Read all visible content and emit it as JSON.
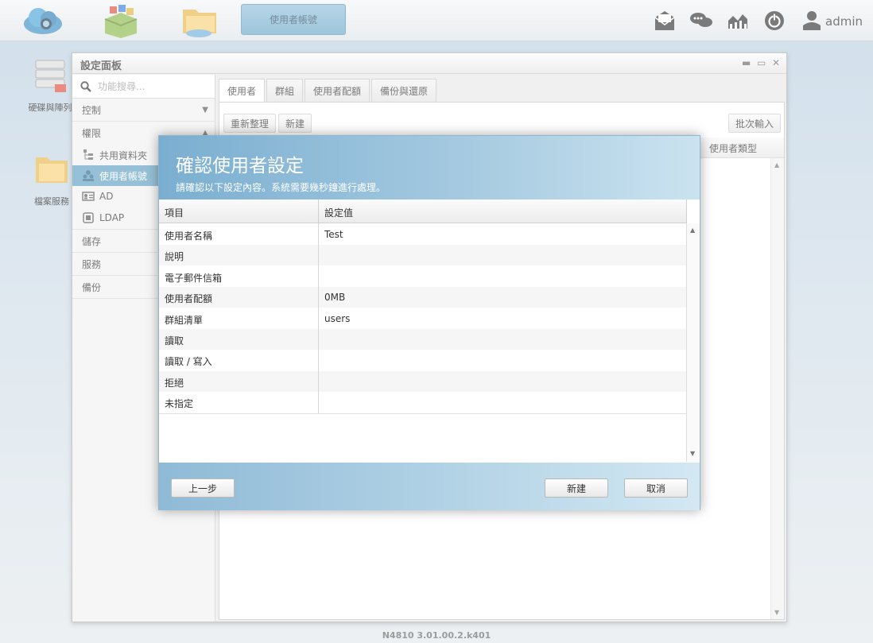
{
  "topbar": {
    "active_app": "使用者帳號",
    "user": "admin"
  },
  "desktop": {
    "icons": [
      "硬碟與陣列",
      "檔案服務"
    ]
  },
  "window": {
    "title": "設定面板",
    "search_placeholder": "功能搜尋...",
    "sidebar": {
      "control": "控制",
      "privilege": "權限",
      "items": [
        "共用資料夾",
        "使用者帳號",
        "AD",
        "LDAP"
      ],
      "storage": "儲存",
      "services": "服務",
      "backup": "備份"
    },
    "tabs": [
      "使用者",
      "群組",
      "使用者配額",
      "備份與還原"
    ],
    "toolbar": {
      "refresh": "重新整理",
      "create": "新建",
      "batch_import": "批次輸入"
    },
    "grid": {
      "user_type_col": "使用者類型"
    }
  },
  "version": "N4810   3.01.00.2.k401",
  "modal": {
    "title": "確認使用者設定",
    "subtitle": "請確認以下設定內容。系統需要幾秒鐘進行處理。",
    "columns": [
      "項目",
      "設定值"
    ],
    "rows": [
      {
        "item": "使用者名稱",
        "value": "Test"
      },
      {
        "item": "說明",
        "value": ""
      },
      {
        "item": "電子郵件信箱",
        "value": ""
      },
      {
        "item": "使用者配額",
        "value": "0MB"
      },
      {
        "item": "群組清單",
        "value": "users"
      },
      {
        "item": "讀取",
        "value": ""
      },
      {
        "item": "讀取 / 寫入",
        "value": ""
      },
      {
        "item": "拒絕",
        "value": ""
      },
      {
        "item": "未指定",
        "value": ""
      }
    ],
    "buttons": {
      "back": "上一步",
      "create": "新建",
      "cancel": "取消"
    }
  }
}
